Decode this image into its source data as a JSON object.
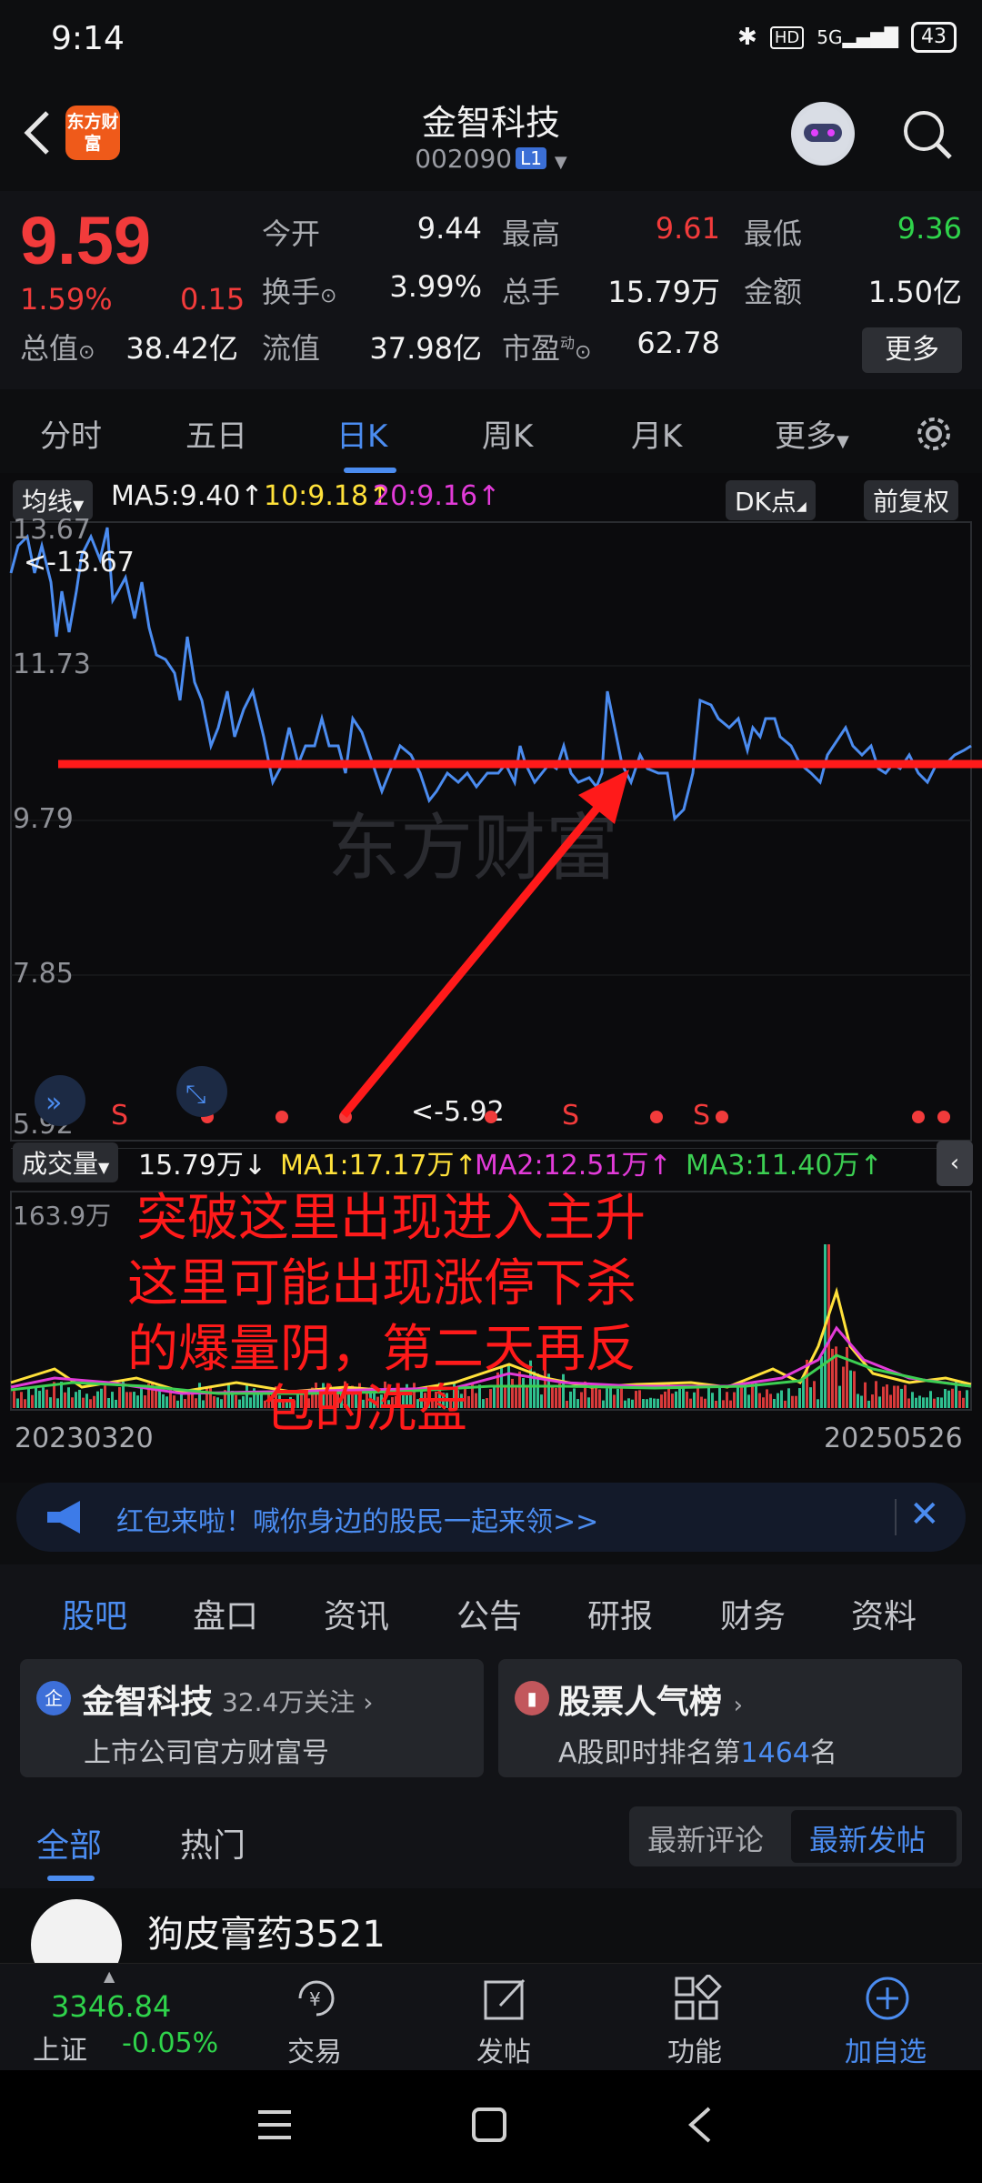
{
  "status_bar": {
    "time": "9:14",
    "bluetooth_icon": "bluetooth-icon",
    "hd": "HD",
    "signal": "5G",
    "battery": "43"
  },
  "header": {
    "logo_text": "东方财富",
    "title": "金智科技",
    "code": "002090",
    "level_badge": "L1"
  },
  "quote": {
    "price": "9.59",
    "change_pct": "1.59%",
    "change": "0.15",
    "market_cap_label": "总值",
    "market_cap": "38.42亿",
    "open_label": "今开",
    "open": "9.44",
    "turnover_label": "换手",
    "turnover": "3.99%",
    "float_label": "流值",
    "float_value": "37.98亿",
    "high_label": "最高",
    "high": "9.61",
    "volume_label": "总手",
    "volume": "15.79万",
    "pe_label": "市盈",
    "pe_superscript": "动",
    "pe": "62.78",
    "low_label": "最低",
    "low": "9.36",
    "amount_label": "金额",
    "amount": "1.50亿",
    "more_button": "更多"
  },
  "chart_tabs": [
    "分时",
    "五日",
    "日K",
    "周K",
    "月K",
    "更多"
  ],
  "chart_tab_active": 2,
  "ma_bar": {
    "selector": "均线",
    "ma5": "MA5:9.40",
    "ma10": "10:9.18",
    "ma20": "20:9.16",
    "dk_button": "DK点",
    "adjust_button": "前复权"
  },
  "price_chart": {
    "y_labels": [
      "13.67",
      "11.73",
      "9.79",
      "7.85",
      "5.92"
    ],
    "max_marker": "<-13.67",
    "min_marker": "<-5.92",
    "sell_markers": [
      "S",
      "S",
      "S"
    ],
    "watermark": "东方财富"
  },
  "volume_bar": {
    "selector": "成交量",
    "volume": "15.79万",
    "ma1": "MA1:17.17万",
    "ma2": "MA2:12.51万",
    "ma3": "MA3:11.40万",
    "max_label": "163.9万",
    "start_date": "20230320",
    "end_date": "20250526"
  },
  "annotation": {
    "line1": "突破这里出现进入主升",
    "line2": "这里可能出现涨停下杀",
    "line3": "的爆量阴，第二天再反",
    "line4": "包的洗盘"
  },
  "banner": {
    "text": "红包来啦！喊你身边的股民一起来领>>"
  },
  "section_tabs": [
    "股吧",
    "盘口",
    "资讯",
    "公告",
    "研报",
    "财务",
    "资料"
  ],
  "section_tab_active": 0,
  "cards": {
    "left_title": "金智科技",
    "left_followers": "32.4万关注",
    "left_sub": "上市公司官方财富号",
    "right_title": "股票人气榜",
    "right_sub_prefix": "A股即时排名第",
    "right_rank": "1464",
    "right_sub_suffix": "名"
  },
  "filter": {
    "all": "全部",
    "hot": "热门",
    "latest_comment": "最新评论",
    "latest_post": "最新发帖"
  },
  "post": {
    "author": "狗皮膏药3521"
  },
  "bottom_bar": {
    "index_value": "3346.84",
    "index_name": "上证",
    "index_change": "-0.05%",
    "trade": "交易",
    "post": "发帖",
    "function": "功能",
    "add_watch": "加自选"
  },
  "colors": {
    "up": "#f23b3b",
    "down": "#2fd34b",
    "accent": "#4b8cf0",
    "price_line": "#4b8cf0",
    "annotation": "#ff1a1a"
  }
}
